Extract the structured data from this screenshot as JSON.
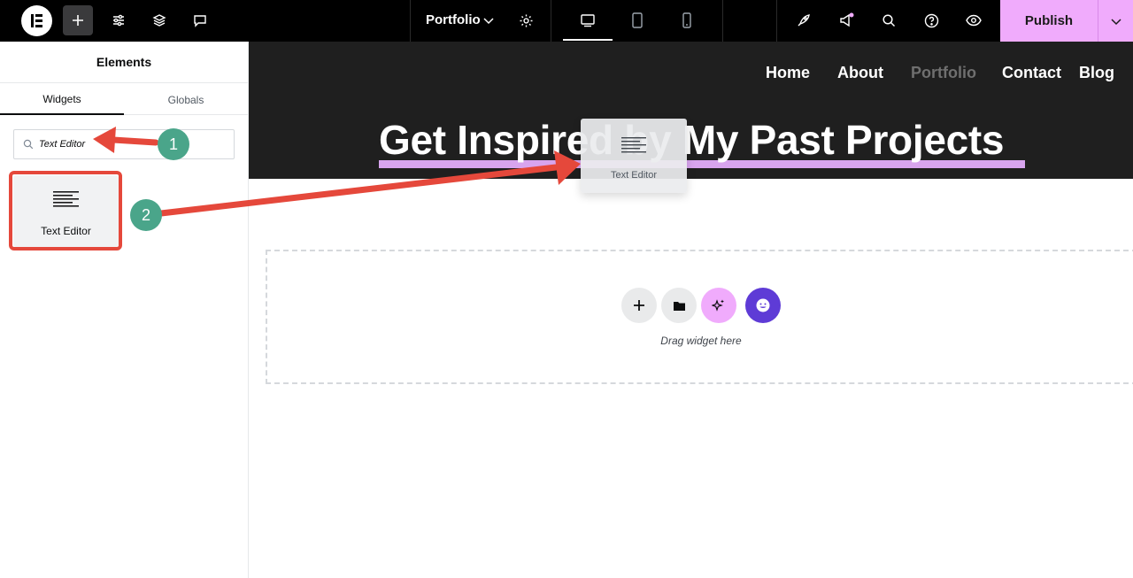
{
  "topbar": {
    "document_title": "Portfolio",
    "publish_label": "Publish",
    "accent_color": "#f0abfc",
    "icons": [
      "elementor-logo-icon",
      "add-element-icon",
      "settings-sliders-icon",
      "layers-icon",
      "comments-icon",
      "chevron-down-icon",
      "gear-icon",
      "desktop-icon",
      "tablet-icon",
      "mobile-icon",
      "rocket-icon",
      "megaphone-icon",
      "search-icon",
      "help-icon",
      "eye-icon"
    ]
  },
  "panel": {
    "title": "Elements",
    "tabs": [
      {
        "label": "Widgets",
        "active": true
      },
      {
        "label": "Globals",
        "active": false
      }
    ],
    "search": {
      "value": "Text Editor",
      "placeholder": ""
    },
    "widgets": [
      {
        "label": "Text Editor",
        "icon": "text-editor-icon"
      }
    ]
  },
  "canvas": {
    "nav": [
      {
        "label": "Home",
        "current": false
      },
      {
        "label": "About",
        "current": false
      },
      {
        "label": "Portfolio",
        "current": true
      },
      {
        "label": "Contact",
        "current": false
      },
      {
        "label": "Blog",
        "current": false
      }
    ],
    "heading": "Get Inspired by My Past Projects",
    "drop_zone_text": "Drag widget here",
    "drag_ghost_label": "Text Editor"
  },
  "annotations": {
    "steps": [
      "1",
      "2"
    ],
    "arrow_color": "#e5483b",
    "badge_color": "#4aa58a"
  }
}
